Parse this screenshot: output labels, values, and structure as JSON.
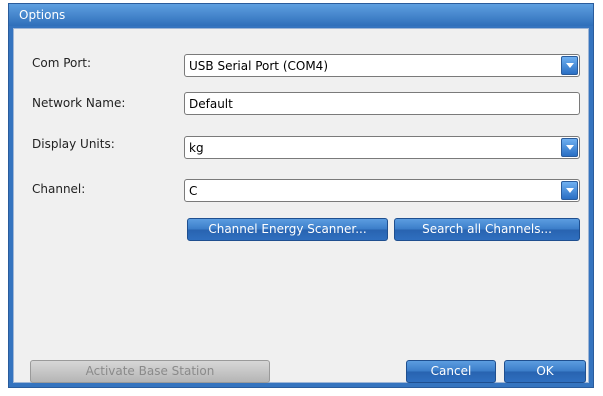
{
  "window": {
    "title": "Options"
  },
  "form": {
    "com_port": {
      "label": "Com Port:",
      "value": "USB Serial Port (COM4)"
    },
    "network_name": {
      "label": "Network Name:",
      "value": "Default"
    },
    "display_units": {
      "label": "Display Units:",
      "value": "kg"
    },
    "channel": {
      "label": "Channel:",
      "value": "C"
    }
  },
  "buttons": {
    "channel_energy_scanner": "Channel Energy Scanner...",
    "search_all_channels": "Search all Channels...",
    "activate_base_station": "Activate Base Station",
    "cancel": "Cancel",
    "ok": "OK"
  },
  "icons": {
    "dropdown": "chevron-down-icon"
  },
  "colors": {
    "title_bar": "#3a7bc6",
    "button": "#3a7cc8",
    "client_bg": "#f0f0f0"
  }
}
